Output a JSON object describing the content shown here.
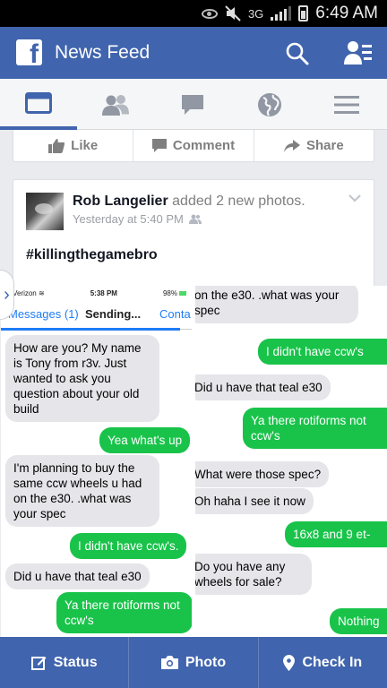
{
  "status_bar": {
    "network": "3G",
    "time": "6:49 AM"
  },
  "header": {
    "title": "News Feed",
    "brand_color": "#4064ad"
  },
  "tabs": [
    {
      "name": "news-feed",
      "icon": "news-feed-icon",
      "active": true
    },
    {
      "name": "friend-requests",
      "icon": "friends-icon",
      "active": false
    },
    {
      "name": "messages",
      "icon": "chat-bubble-icon",
      "active": false
    },
    {
      "name": "notifications",
      "icon": "globe-icon",
      "active": false
    },
    {
      "name": "more",
      "icon": "hamburger-menu-icon",
      "active": false
    }
  ],
  "previous_post_actions": {
    "like": "Like",
    "comment": "Comment",
    "share": "Share"
  },
  "post": {
    "author": "Rob Langelier",
    "action": "added 2 new photos.",
    "time": "Yesterday at 5:40 PM",
    "text": "#killingthegamebro",
    "photo1": {
      "carrier": "Verizon",
      "time": "5:38 PM",
      "battery": "98%",
      "back": "Messages (1)",
      "title": "Sending...",
      "contact": "Conta",
      "messages": [
        {
          "dir": "in",
          "text": "How are you? My name is Tony from r3v. Just wanted to ask you question about your old build"
        },
        {
          "dir": "out",
          "text": "Yea what's up"
        },
        {
          "dir": "in",
          "text": "I'm planning to buy the same ccw wheels u had on the e30. .what was your spec"
        },
        {
          "dir": "out",
          "text": "I didn't have ccw's."
        },
        {
          "dir": "in",
          "text": "Did u have that teal e30"
        },
        {
          "dir": "out",
          "text": "Ya there rotiforms not ccw's"
        }
      ]
    },
    "photo2": {
      "messages": [
        {
          "dir": "in",
          "text": "on the e30. .what was your spec"
        },
        {
          "dir": "out",
          "text": "I didn't have ccw's"
        },
        {
          "dir": "in",
          "text": "Did u have that teal e30"
        },
        {
          "dir": "out",
          "text": "Ya there rotiforms not ccw's"
        },
        {
          "dir": "in",
          "text": "What were those spec?"
        },
        {
          "dir": "in",
          "text": "Oh haha I see it now"
        },
        {
          "dir": "out",
          "text": "16x8 and 9 et-"
        },
        {
          "dir": "in",
          "text": "Do you have any wheels for sale?"
        },
        {
          "dir": "out",
          "text": "Nothing"
        }
      ]
    }
  },
  "composer": {
    "status": "Status",
    "photo": "Photo",
    "check_in": "Check In"
  },
  "colors": {
    "ios_incoming": "#e5e5ea",
    "ios_outgoing": "#19c34a",
    "ios_link": "#1f7cf5"
  }
}
